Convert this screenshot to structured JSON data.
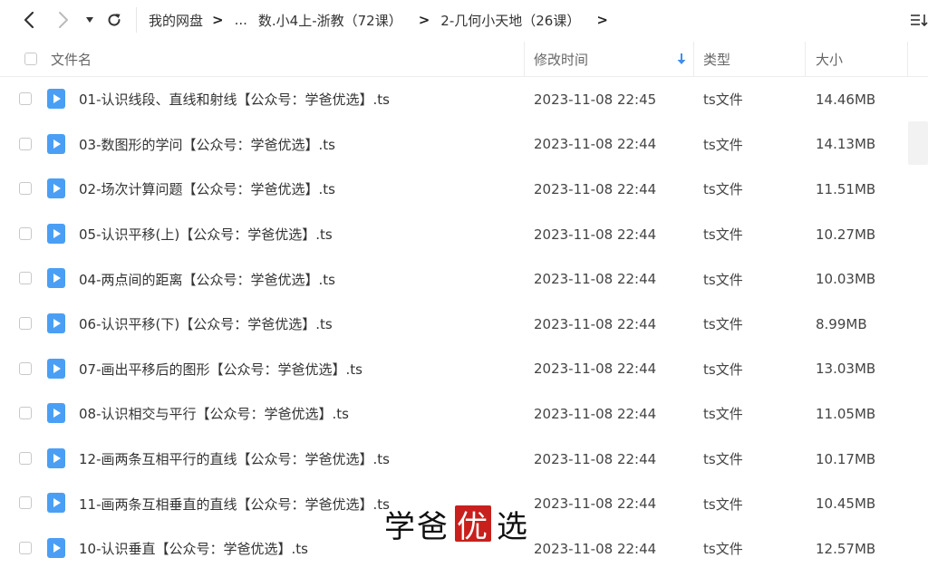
{
  "nav": {
    "back_icon": "chevron-left-icon",
    "forward_icon": "chevron-right-icon",
    "dropdown_icon": "caret-down-icon",
    "refresh_icon": "refresh-icon",
    "sort_icon": "sort-list-icon"
  },
  "breadcrumb": {
    "items": [
      "我的网盘",
      "数.小4上-浙教（72课）",
      "2-几何小天地（26课）"
    ],
    "ellipsis": "..."
  },
  "columns": {
    "name": "文件名",
    "modified": "修改时间",
    "type": "类型",
    "size": "大小"
  },
  "colors": {
    "file_icon": "#4a9ff5",
    "sort_arrow": "#3d8ff0",
    "watermark_red": "#c8201d"
  },
  "files": [
    {
      "name": "01-认识线段、直线和射线【公众号：学爸优选】.ts",
      "modified": "2023-11-08 22:45",
      "type": "ts文件",
      "size": "14.46MB"
    },
    {
      "name": "03-数图形的学问【公众号：学爸优选】.ts",
      "modified": "2023-11-08 22:44",
      "type": "ts文件",
      "size": "14.13MB"
    },
    {
      "name": "02-场次计算问题【公众号：学爸优选】.ts",
      "modified": "2023-11-08 22:44",
      "type": "ts文件",
      "size": "11.51MB"
    },
    {
      "name": "05-认识平移(上)【公众号：学爸优选】.ts",
      "modified": "2023-11-08 22:44",
      "type": "ts文件",
      "size": "10.27MB"
    },
    {
      "name": "04-两点间的距离【公众号：学爸优选】.ts",
      "modified": "2023-11-08 22:44",
      "type": "ts文件",
      "size": "10.03MB"
    },
    {
      "name": "06-认识平移(下)【公众号：学爸优选】.ts",
      "modified": "2023-11-08 22:44",
      "type": "ts文件",
      "size": "8.99MB"
    },
    {
      "name": "07-画出平移后的图形【公众号：学爸优选】.ts",
      "modified": "2023-11-08 22:44",
      "type": "ts文件",
      "size": "13.03MB"
    },
    {
      "name": "08-认识相交与平行【公众号：学爸优选】.ts",
      "modified": "2023-11-08 22:44",
      "type": "ts文件",
      "size": "11.05MB"
    },
    {
      "name": "12-画两条互相平行的直线【公众号：学爸优选】.ts",
      "modified": "2023-11-08 22:44",
      "type": "ts文件",
      "size": "10.17MB"
    },
    {
      "name": "11-画两条互相垂直的直线【公众号：学爸优选】.ts",
      "modified": "2023-11-08 22:44",
      "type": "ts文件",
      "size": "10.45MB"
    },
    {
      "name": "10-认识垂直【公众号：学爸优选】.ts",
      "modified": "2023-11-08 22:44",
      "type": "ts文件",
      "size": "12.57MB"
    }
  ],
  "watermark": {
    "left": "学爸",
    "highlight": "优",
    "right": "选"
  }
}
